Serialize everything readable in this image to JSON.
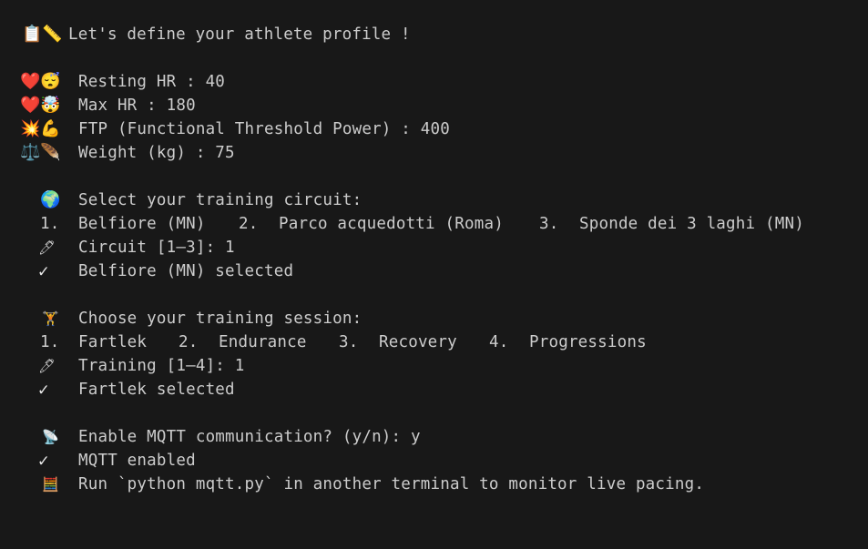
{
  "header": {
    "icons": [
      "clipboard-icon",
      "ruler-icon"
    ],
    "icon_glyphs": [
      "📋",
      "📏"
    ],
    "text": "Let's define your athlete profile !"
  },
  "profile": [
    {
      "icons": [
        "heart-icon",
        "sleeping-face-icon"
      ],
      "glyphs": [
        "❤️",
        "😴"
      ],
      "text": "Resting HR : 40"
    },
    {
      "icons": [
        "heart-icon",
        "exploding-head-icon"
      ],
      "glyphs": [
        "❤️",
        "🤯"
      ],
      "text": "Max HR : 180"
    },
    {
      "icons": [
        "collision-icon",
        "flexed-biceps-icon"
      ],
      "glyphs": [
        "💥",
        "💪"
      ],
      "text": "FTP (Functional Threshold Power) : 400"
    },
    {
      "icons": [
        "balance-scale-icon",
        "feather-icon"
      ],
      "glyphs": [
        "⚖️",
        "🪶"
      ],
      "text": "Weight (kg) : 75"
    }
  ],
  "circuit": {
    "icon": "globe-icon",
    "icon_glyph": "🌍",
    "prompt": "Select your training circuit:",
    "options": [
      {
        "num": "1.",
        "label": "Belfiore (MN)"
      },
      {
        "num": "2.",
        "label": "Parco acquedotti (Roma)"
      },
      {
        "num": "3.",
        "label": "Sponde dei 3 laghi (MN)"
      }
    ],
    "input_icon": "pencil-icon",
    "input_glyph": "🖊",
    "input_text": "Circuit [1–3]: 1",
    "check_glyph": "✓",
    "selected_text": "Belfiore (MN) selected"
  },
  "session": {
    "icon": "dumbbell-icon",
    "icon_glyph": "🏋",
    "prompt": "Choose your training session:",
    "options": [
      {
        "num": "1.",
        "label": "Fartlek"
      },
      {
        "num": "2.",
        "label": "Endurance"
      },
      {
        "num": "3.",
        "label": "Recovery"
      },
      {
        "num": "4.",
        "label": "Progressions"
      }
    ],
    "input_icon": "pencil-icon",
    "input_glyph": "🖊",
    "input_text": "Training [1–4]: 1",
    "check_glyph": "✓",
    "selected_text": "Fartlek selected"
  },
  "mqtt": {
    "icon": "satellite-antenna-icon",
    "icon_glyph": "📡",
    "prompt": "Enable MQTT communication? (y/n): y",
    "check_glyph": "✓",
    "enabled_text": "MQTT enabled",
    "run_icon": "abacus-icon",
    "run_glyph": "🧮",
    "run_text": "Run `python mqtt.py` in another terminal to monitor live pacing."
  }
}
